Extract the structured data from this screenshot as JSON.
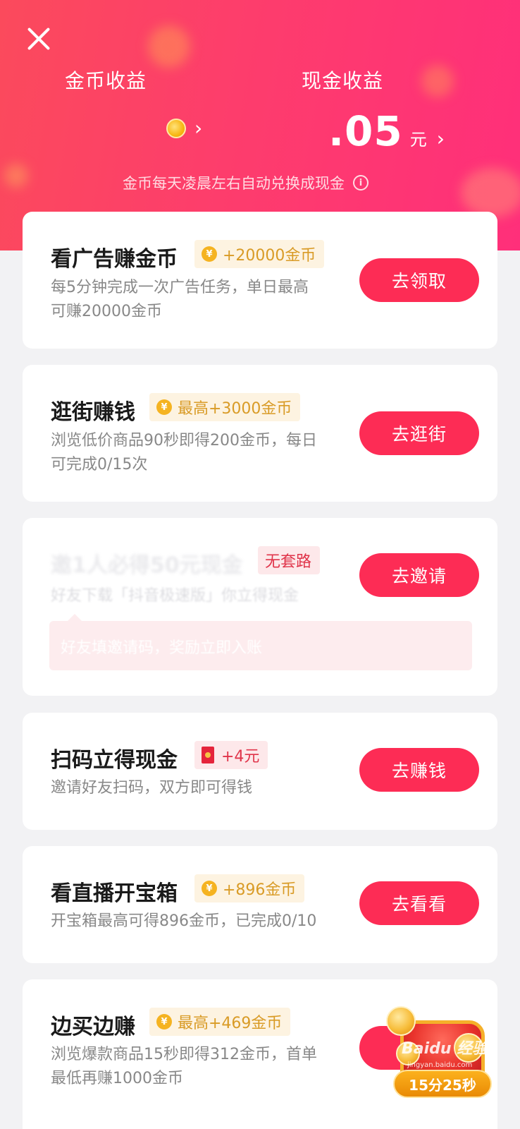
{
  "header": {
    "coin_label": "金币收益",
    "cash_label": "现金收益",
    "cash_value": ".05",
    "cash_unit": "元",
    "chevron": "›",
    "exchange_note": "金币每天凌晨左右自动兑换成现金",
    "info_glyph": "i",
    "colors": {
      "gradient_start": "#fb4a5c",
      "gradient_end": "#ff2f7a"
    }
  },
  "tasks": [
    {
      "title": "看广告赚金币",
      "badge": "+20000金币",
      "badge_type": "coin",
      "desc_lines": [
        "每5分钟完成一次广告任务，单日最高",
        "可赚20000金币"
      ],
      "button": "去领取"
    },
    {
      "title": "逛街赚钱",
      "badge": "最高+3000金币",
      "badge_type": "coin",
      "desc_lines": [
        "浏览低价商品90秒即得200金币，每日",
        "可完成0/15次"
      ],
      "button": "去逛街"
    },
    {
      "title": "邀1人必得50元现金",
      "badge": "无套路",
      "badge_type": "cash",
      "desc_lines": [
        "好友下载「抖音极速版」你立得现金"
      ],
      "sub_note": "好友填邀请码，奖励立即入账",
      "button": "去邀请"
    },
    {
      "title": "扫码立得现金",
      "badge": "+4元",
      "badge_type": "envelope",
      "desc_lines": [
        "邀请好友扫码，双方即可得钱"
      ],
      "button": "去赚钱"
    },
    {
      "title": "看直播开宝箱",
      "badge": "+896金币",
      "badge_type": "coin",
      "desc_lines": [
        "开宝箱最高可得896金币，已完成0/10"
      ],
      "button": "去看看"
    },
    {
      "title": "边买边赚",
      "badge": "最高+469金币",
      "badge_type": "coin",
      "desc_lines": [
        "浏览爆款商品15秒即得312金币，首单",
        "最低再赚1000金币"
      ],
      "button": "去"
    }
  ],
  "coin_glyph": "¥",
  "treasure_chest": {
    "timer": "15分25秒"
  },
  "watermark": {
    "brand": "Baidu 经验",
    "url": "jingyan.baidu.com"
  },
  "colors": {
    "accent": "#fd2c55",
    "coin_badge_bg": "#fdf3e1",
    "coin_badge_text": "#d99b26"
  }
}
